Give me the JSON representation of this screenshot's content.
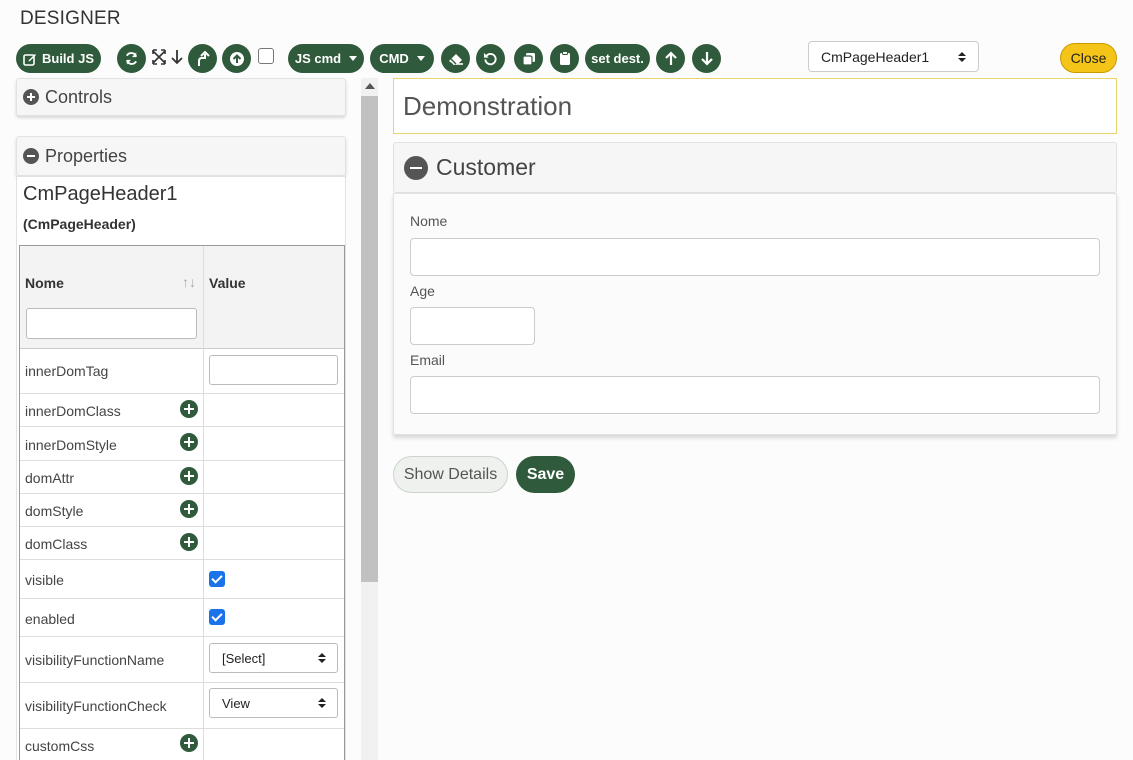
{
  "app": {
    "title": "DESIGNER"
  },
  "toolbar": {
    "build_label": "Build JS",
    "js_cmd_label": "JS cmd",
    "cmd_label": "CMD",
    "set_dest_label": "set dest.",
    "selected_component": "CmPageHeader1",
    "close_label": "Close"
  },
  "panels": {
    "controls_label": "Controls",
    "properties_label": "Properties"
  },
  "properties": {
    "object_name": "CmPageHeader1",
    "object_type": "(CmPageHeader)",
    "col_name": "Nome",
    "col_value": "Value",
    "rows": [
      {
        "name": "innerDomTag",
        "kind": "input"
      },
      {
        "name": "innerDomClass",
        "kind": "add"
      },
      {
        "name": "innerDomStyle",
        "kind": "add"
      },
      {
        "name": "domAttr",
        "kind": "add"
      },
      {
        "name": "domStyle",
        "kind": "add"
      },
      {
        "name": "domClass",
        "kind": "add"
      },
      {
        "name": "visible",
        "kind": "checkbox",
        "checked": true
      },
      {
        "name": "enabled",
        "kind": "checkbox",
        "checked": true
      },
      {
        "name": "visibilityFunctionName",
        "kind": "select",
        "value": "[Select]"
      },
      {
        "name": "visibilityFunctionCheck",
        "kind": "select",
        "value": "View"
      },
      {
        "name": "customCss",
        "kind": "add"
      }
    ]
  },
  "canvas": {
    "page_header": "Demonstration",
    "section_title": "Customer",
    "fields": [
      {
        "label": "Nome",
        "value": ""
      },
      {
        "label": "Age",
        "value": ""
      },
      {
        "label": "Email",
        "value": ""
      }
    ],
    "show_details_label": "Show Details",
    "save_label": "Save"
  },
  "colors": {
    "primary_green": "#2f5b3c",
    "close_yellow": "#f5c419",
    "header_border": "#e8d46a",
    "checkbox_blue": "#1a73e8"
  },
  "icons": {
    "build": "edit-icon",
    "refresh": "refresh-icon",
    "expand": "expand-icon",
    "arrow_down": "arrow-down-icon",
    "turn_up": "turn-up-icon",
    "circle_up": "circle-arrow-up-icon",
    "eraser": "eraser-icon",
    "undo": "undo-icon",
    "copy": "copy-icon",
    "paste": "paste-icon",
    "up": "arrow-up-icon",
    "down": "arrow-down-icon"
  }
}
